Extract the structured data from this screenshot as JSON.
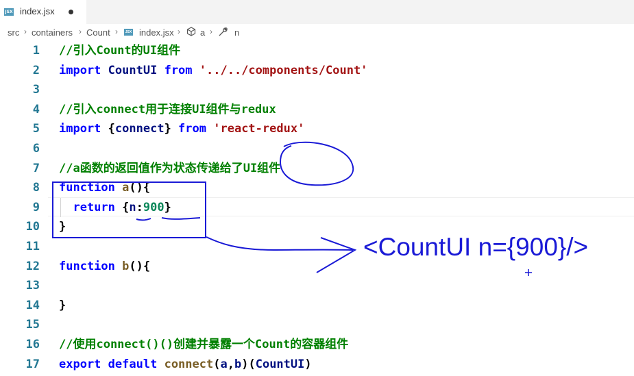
{
  "tab": {
    "title": "index.jsx",
    "file_icon": "JSX"
  },
  "breadcrumb": {
    "items": [
      "src",
      "containers",
      "Count",
      "index.jsx",
      "a",
      "n"
    ]
  },
  "code": {
    "lines": [
      {
        "num": "1",
        "tokens": [
          {
            "c": "cmt",
            "t": "//引入Count的UI组件"
          }
        ]
      },
      {
        "num": "2",
        "tokens": [
          {
            "c": "kw",
            "t": "import"
          },
          {
            "c": "pl",
            "t": " "
          },
          {
            "c": "nm",
            "t": "CountUI"
          },
          {
            "c": "pl",
            "t": " "
          },
          {
            "c": "kw",
            "t": "from"
          },
          {
            "c": "pl",
            "t": " "
          },
          {
            "c": "str",
            "t": "'../../components/Count'"
          }
        ]
      },
      {
        "num": "3",
        "tokens": []
      },
      {
        "num": "4",
        "tokens": [
          {
            "c": "cmt",
            "t": "//引入connect用于连接UI组件与redux"
          }
        ]
      },
      {
        "num": "5",
        "tokens": [
          {
            "c": "kw",
            "t": "import"
          },
          {
            "c": "pl",
            "t": " {"
          },
          {
            "c": "nm",
            "t": "connect"
          },
          {
            "c": "pl",
            "t": "} "
          },
          {
            "c": "kw",
            "t": "from"
          },
          {
            "c": "pl",
            "t": " "
          },
          {
            "c": "str",
            "t": "'react-redux'"
          }
        ]
      },
      {
        "num": "6",
        "tokens": []
      },
      {
        "num": "7",
        "tokens": [
          {
            "c": "cmt",
            "t": "//a函数的返回值作为状态传递给了UI组件"
          }
        ]
      },
      {
        "num": "8",
        "tokens": [
          {
            "c": "kw",
            "t": "function"
          },
          {
            "c": "pl",
            "t": " "
          },
          {
            "c": "fn",
            "t": "a"
          },
          {
            "c": "pl",
            "t": "(){"
          }
        ]
      },
      {
        "num": "9",
        "tokens": [
          {
            "c": "pl",
            "t": "  "
          },
          {
            "c": "kw",
            "t": "return"
          },
          {
            "c": "pl",
            "t": " {"
          },
          {
            "c": "nm",
            "t": "n"
          },
          {
            "c": "pl",
            "t": ":"
          },
          {
            "c": "num",
            "t": "900"
          },
          {
            "c": "pl",
            "t": "}"
          }
        ]
      },
      {
        "num": "10",
        "tokens": [
          {
            "c": "pl",
            "t": "}"
          }
        ]
      },
      {
        "num": "11",
        "tokens": []
      },
      {
        "num": "12",
        "tokens": [
          {
            "c": "kw",
            "t": "function"
          },
          {
            "c": "pl",
            "t": " "
          },
          {
            "c": "fn",
            "t": "b"
          },
          {
            "c": "pl",
            "t": "(){"
          }
        ]
      },
      {
        "num": "13",
        "tokens": []
      },
      {
        "num": "14",
        "tokens": [
          {
            "c": "pl",
            "t": "}"
          }
        ]
      },
      {
        "num": "15",
        "tokens": []
      },
      {
        "num": "16",
        "tokens": [
          {
            "c": "cmt",
            "t": "//使用connect()()创建并暴露一个Count的容器组件"
          }
        ]
      },
      {
        "num": "17",
        "tokens": [
          {
            "c": "kw",
            "t": "export"
          },
          {
            "c": "pl",
            "t": " "
          },
          {
            "c": "kw",
            "t": "default"
          },
          {
            "c": "pl",
            "t": " "
          },
          {
            "c": "fn",
            "t": "connect"
          },
          {
            "c": "pl",
            "t": "("
          },
          {
            "c": "nm",
            "t": "a"
          },
          {
            "c": "pl",
            "t": ","
          },
          {
            "c": "nm",
            "t": "b"
          },
          {
            "c": "pl",
            "t": ")("
          },
          {
            "c": "nm",
            "t": "CountUI"
          },
          {
            "c": "pl",
            "t": ")"
          }
        ]
      }
    ]
  },
  "annotation": {
    "text": "<CountUI n={900}/>",
    "color": "#1a1ad6"
  },
  "icons": {
    "tab_file": "jsx-file-icon",
    "modified": "unsaved-dot-icon",
    "symbol_a": "cube-icon",
    "symbol_n": "wrench-icon"
  }
}
